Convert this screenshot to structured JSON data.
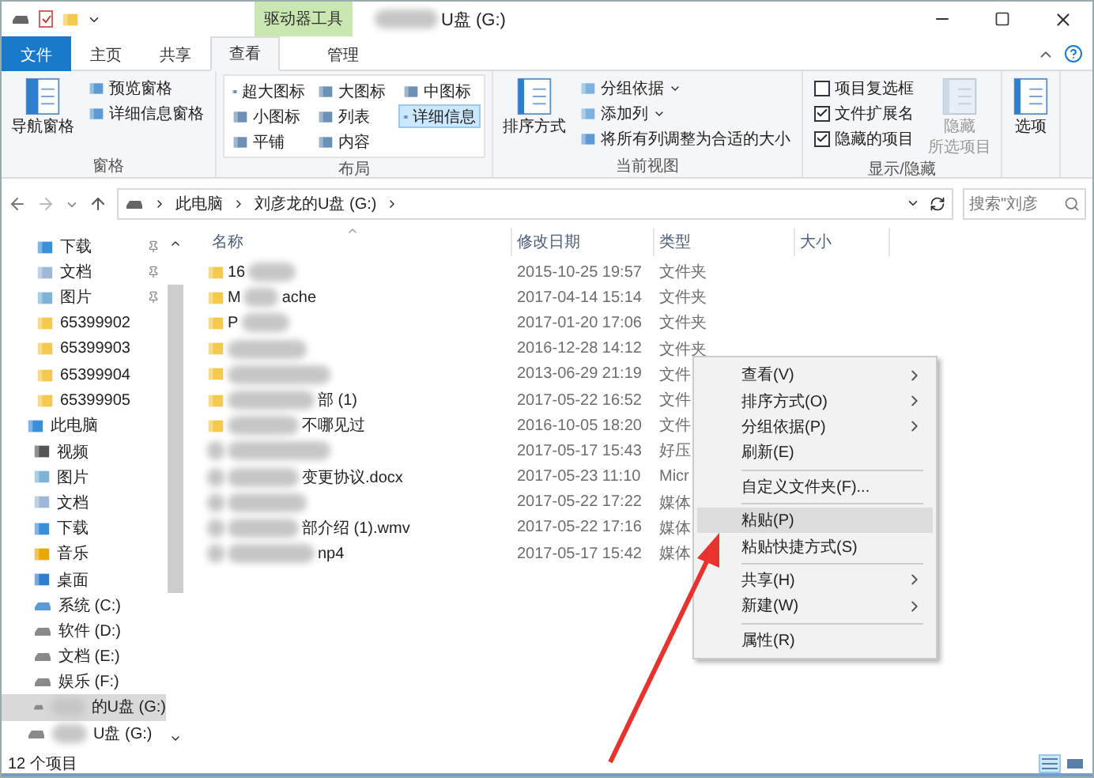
{
  "window": {
    "title": "U盘 (G:)",
    "context_tab": "驱动器工具"
  },
  "tabs": [
    {
      "label": "文件",
      "kind": "file",
      "selected": false
    },
    {
      "label": "主页",
      "kind": "tab",
      "selected": false
    },
    {
      "label": "共享",
      "kind": "tab",
      "selected": false
    },
    {
      "label": "查看",
      "kind": "tab",
      "selected": true
    },
    {
      "label": "管理",
      "kind": "context",
      "selected": false
    }
  ],
  "ribbon": [
    {
      "label": "窗格",
      "items": [
        {
          "kind": "large",
          "label": "导航窗格"
        },
        {
          "kind": "small",
          "label": "预览窗格"
        },
        {
          "kind": "small",
          "label": "详细信息窗格"
        }
      ]
    },
    {
      "label": "布局",
      "items": [
        {
          "kind": "view",
          "label": "超大图标",
          "selected": false
        },
        {
          "kind": "view",
          "label": "大图标",
          "selected": false
        },
        {
          "kind": "view",
          "label": "中图标",
          "selected": false
        },
        {
          "kind": "view",
          "label": "小图标",
          "selected": false
        },
        {
          "kind": "view",
          "label": "列表",
          "selected": false
        },
        {
          "kind": "view",
          "label": "详细信息",
          "selected": true
        },
        {
          "kind": "view",
          "label": "平铺",
          "selected": false
        },
        {
          "kind": "view",
          "label": "内容",
          "selected": false
        }
      ]
    },
    {
      "label": "当前视图",
      "items": [
        {
          "kind": "large",
          "label": "排序方式"
        },
        {
          "kind": "dropdown",
          "label": "分组依据"
        },
        {
          "kind": "dropdown",
          "label": "添加列"
        },
        {
          "kind": "small",
          "label": "将所有列调整为合适的大小"
        }
      ]
    },
    {
      "label": "显示/隐藏",
      "items": [
        {
          "kind": "check",
          "label": "项目复选框",
          "checked": false
        },
        {
          "kind": "check",
          "label": "文件扩展名",
          "checked": true
        },
        {
          "kind": "check",
          "label": "隐藏的项目",
          "checked": true
        },
        {
          "kind": "large",
          "label": "隐藏",
          "label2": "所选项目",
          "disabled": true
        }
      ]
    },
    {
      "items": [
        {
          "kind": "large",
          "label": "选项"
        }
      ]
    }
  ],
  "address": {
    "crumbs": [
      "此电脑",
      "刘彦龙的U盘 (G:)"
    ],
    "search_placeholder": "搜索\"刘彦"
  },
  "sidebar": [
    {
      "label": "下载",
      "kind": "download",
      "pinned": true,
      "selected": false
    },
    {
      "label": "文档",
      "kind": "docs",
      "pinned": true,
      "selected": false
    },
    {
      "label": "图片",
      "kind": "pictures",
      "pinned": true,
      "selected": false
    },
    {
      "label": "65399902",
      "kind": "folder",
      "pinned": false,
      "selected": false
    },
    {
      "label": "65399903",
      "kind": "folder",
      "pinned": false,
      "selected": false
    },
    {
      "label": "65399904",
      "kind": "folder",
      "pinned": false,
      "selected": false
    },
    {
      "label": "65399905",
      "kind": "folder",
      "pinned": false,
      "selected": false
    },
    {
      "label": "此电脑",
      "kind": "pc",
      "pinned": false,
      "selected": false,
      "children": [
        {
          "label": "视频",
          "kind": "video",
          "selected": false
        },
        {
          "label": "图片",
          "kind": "pictures",
          "selected": false
        },
        {
          "label": "文档",
          "kind": "docs",
          "selected": false
        },
        {
          "label": "下载",
          "kind": "download",
          "selected": false
        },
        {
          "label": "音乐",
          "kind": "music",
          "selected": false
        },
        {
          "label": "桌面",
          "kind": "desktop",
          "selected": false
        },
        {
          "label": "系统 (C:)",
          "kind": "sysdrive",
          "selected": false
        },
        {
          "label": "软件 (D:)",
          "kind": "drive",
          "selected": false
        },
        {
          "label": "文档 (E:)",
          "kind": "drive",
          "selected": false
        },
        {
          "label": "娱乐 (F:)",
          "kind": "drive",
          "selected": false
        },
        {
          "label": "的U盘 (G:)",
          "kind": "drive",
          "selected": true
        }
      ]
    },
    {
      "label": "U盘 (G:)",
      "kind": "drive",
      "pinned": false,
      "selected": false
    }
  ],
  "columns": [
    "名称",
    "修改日期",
    "类型",
    "大小"
  ],
  "files": [
    {
      "name": [
        "16"
      ],
      "blur_before": false,
      "blur_after": true,
      "date": "2015-10-25 19:57",
      "type": "文件夹",
      "kind": "folder"
    },
    {
      "name": [
        "M",
        "ache"
      ],
      "blur_before": false,
      "blur_after": false,
      "date": "2017-04-14 15:14",
      "type": "文件夹",
      "kind": "folder"
    },
    {
      "name": [
        "P"
      ],
      "blur_before": false,
      "blur_after": true,
      "date": "2017-01-20 17:06",
      "type": "文件夹",
      "kind": "folder"
    },
    {
      "blur_before": true,
      "blur_after": false,
      "date": "2016-12-28 14:12",
      "type": "文件夹",
      "kind": "folder"
    },
    {
      "blur_before": true,
      "blur_after": false,
      "date": "2013-06-29 21:19",
      "type": "文件",
      "kind": "folder"
    },
    {
      "name": [
        "部 (1)"
      ],
      "blur_before": true,
      "blur_after": false,
      "date": "2017-05-22 16:52",
      "type": "文件",
      "kind": "folder"
    },
    {
      "name": [
        "不哪见过"
      ],
      "blur_before": true,
      "blur_after": false,
      "date": "2016-10-05 18:20",
      "type": "文件",
      "kind": "folder"
    },
    {
      "blur_before": true,
      "blur_after": false,
      "date": "2017-05-17 15:43",
      "type": "好压",
      "kind": "file"
    },
    {
      "name": [
        "变更协议.docx"
      ],
      "blur_before": true,
      "blur_after": false,
      "date": "2017-05-23 11:10",
      "type": "Micr",
      "kind": "file"
    },
    {
      "blur_before": true,
      "blur_after": false,
      "date": "2017-05-22 17:22",
      "type": "媒体",
      "kind": "file"
    },
    {
      "name": [
        "部介绍 (1).wmv"
      ],
      "blur_before": true,
      "blur_after": false,
      "date": "2017-05-22 17:16",
      "type": "媒体",
      "kind": "file"
    },
    {
      "name": [
        "np4"
      ],
      "blur_before": true,
      "blur_after": false,
      "date": "2017-05-17 15:42",
      "type": "媒体",
      "kind": "file"
    }
  ],
  "context_menu": [
    {
      "kind": "submenu",
      "label": "查看(V)",
      "selected": false
    },
    {
      "kind": "submenu",
      "label": "排序方式(O)",
      "selected": false
    },
    {
      "kind": "submenu",
      "label": "分组依据(P)",
      "selected": false
    },
    {
      "kind": "item",
      "label": "刷新(E)",
      "selected": false
    },
    {
      "kind": "separator"
    },
    {
      "kind": "item",
      "label": "自定义文件夹(F)...",
      "selected": false
    },
    {
      "kind": "separator"
    },
    {
      "kind": "item",
      "label": "粘贴(P)",
      "selected": true
    },
    {
      "kind": "item",
      "label": "粘贴快捷方式(S)",
      "selected": false
    },
    {
      "kind": "separator"
    },
    {
      "kind": "submenu",
      "label": "共享(H)",
      "selected": false
    },
    {
      "kind": "submenu",
      "label": "新建(W)",
      "selected": false
    },
    {
      "kind": "separator"
    },
    {
      "kind": "item",
      "label": "属性(R)",
      "selected": false
    }
  ],
  "status_bar": {
    "count": "12 个项目",
    "views": [
      {
        "kind": "details",
        "selected": true
      },
      {
        "kind": "large",
        "selected": false
      }
    ]
  }
}
